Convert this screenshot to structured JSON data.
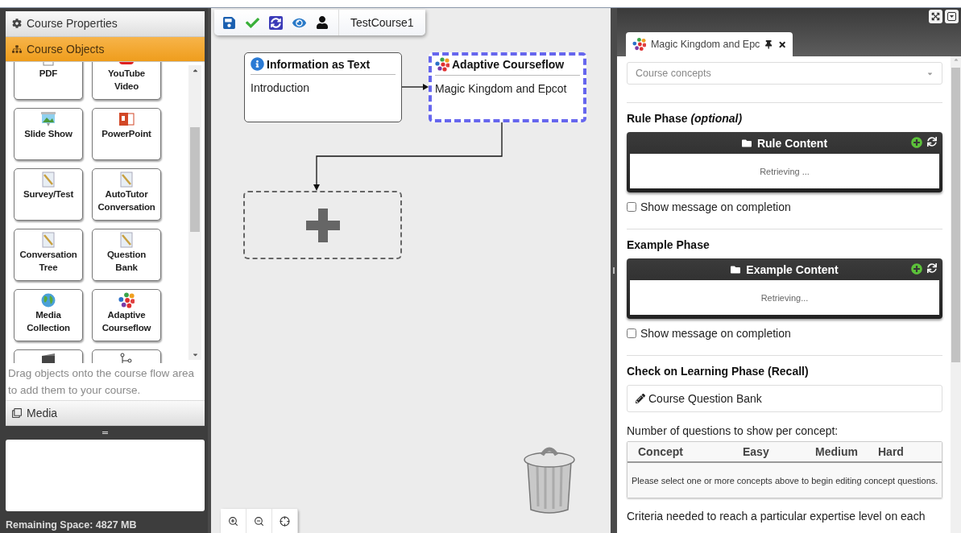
{
  "left_panel": {
    "sections": [
      {
        "label": "Course Properties",
        "kind": "properties",
        "expanded": false
      },
      {
        "label": "Course Objects",
        "kind": "objects",
        "expanded": true
      },
      {
        "label": "Media",
        "kind": "media",
        "expanded": false
      }
    ],
    "objects": [
      {
        "label": "PDF",
        "kind": "pdf"
      },
      {
        "label": "YouTube Video",
        "kind": "video"
      },
      {
        "label": "Slide Show",
        "kind": "slides"
      },
      {
        "label": "PowerPoint",
        "kind": "powerpoint"
      },
      {
        "label": "Survey/Test",
        "kind": "document"
      },
      {
        "label": "AutoTutor Conversation",
        "kind": "document"
      },
      {
        "label": "Conversation Tree",
        "kind": "document"
      },
      {
        "label": "Question Bank",
        "kind": "document"
      },
      {
        "label": "Media Collection",
        "kind": "globe"
      },
      {
        "label": "Adaptive Courseflow",
        "kind": "adaptive"
      },
      {
        "kind": "film"
      },
      {
        "kind": "tree"
      }
    ],
    "hint": "Drag objects onto the course flow area to add them to your course.",
    "remaining_space": "Remaining Space: 4827 MB"
  },
  "toolbar": {
    "course_name": "TestCourse1"
  },
  "flow": {
    "nodes": [
      {
        "title": "Information as Text",
        "subtitle": "Introduction",
        "kind": "info",
        "selected": false
      },
      {
        "title": "Adaptive Courseflow",
        "subtitle": "Magic Kingdom and Epcot",
        "kind": "adaptive",
        "selected": true
      }
    ]
  },
  "editor": {
    "tab": {
      "label": "Magic Kingdom and Epc"
    },
    "concepts_select": {
      "placeholder": "Course concepts"
    },
    "phases": [
      {
        "title": "Rule Phase *(optional)*",
        "box_title": "Rule Content",
        "status": "Retrieving ...",
        "checkbox": {
          "label": "Show message on completion",
          "checked": false
        }
      },
      {
        "title": "Example Phase",
        "box_title": "Example Content",
        "status": "Retrieving...",
        "checkbox": {
          "label": "Show message on completion",
          "checked": false
        }
      }
    ],
    "recall": {
      "title": "Check on Learning Phase (Recall)",
      "button": "Course Question Bank",
      "table_label": "Number of questions to show per concept:",
      "columns": [
        "Concept",
        "Easy",
        "Medium",
        "Hard"
      ],
      "empty_message": "Please select one or more concepts above to begin editing concept questions.",
      "criteria": "Criteria needed to reach a particular expertise level on each"
    }
  }
}
